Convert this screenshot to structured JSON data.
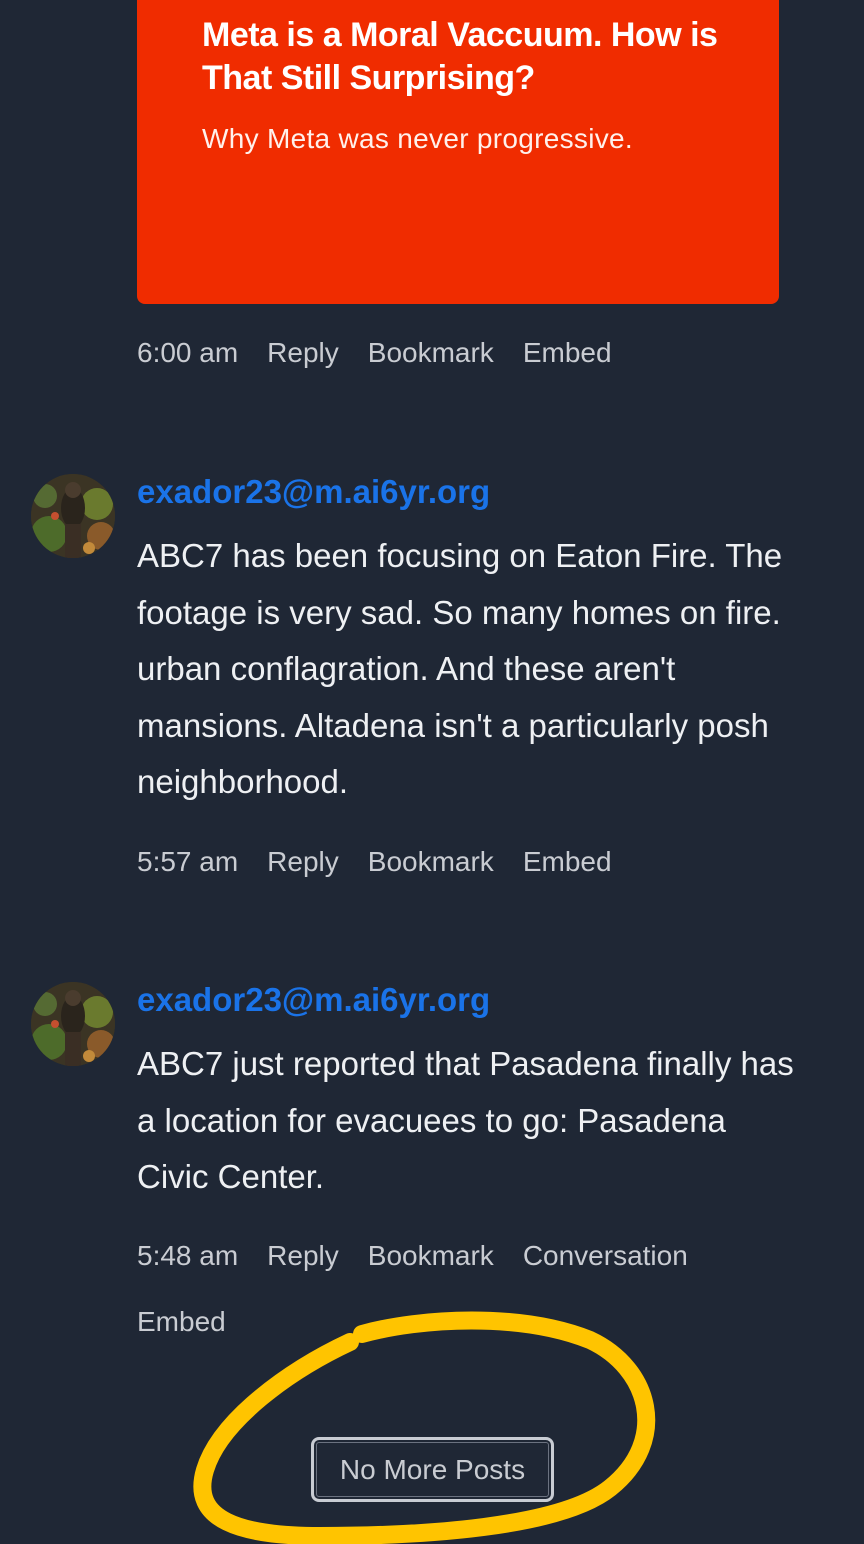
{
  "card": {
    "title": "Meta is a Moral Vaccuum. How is That Still Surprising?",
    "subtitle": "Why Meta was never progressive.",
    "color": "#f02c00"
  },
  "first_meta": {
    "time": "6:00 am",
    "reply": "Reply",
    "bookmark": "Bookmark",
    "embed": "Embed"
  },
  "posts": [
    {
      "author": "exador23@m.ai6yr.org",
      "content": "ABC7 has been focusing on Eaton Fire. The footage is very sad. So many homes on fire. urban conflagration. And these aren't mansions. Altadena isn't a particularly posh neighborhood.",
      "time": "5:57 am",
      "reply": "Reply",
      "bookmark": "Bookmark",
      "embed": "Embed"
    },
    {
      "author": "exador23@m.ai6yr.org",
      "content": "ABC7 just reported that Pasadena finally has a location for evacuees to go: Pasadena Civic Center.",
      "time": "5:48 am",
      "reply": "Reply",
      "bookmark": "Bookmark",
      "conversation": "Conversation",
      "embed": "Embed"
    }
  ],
  "footer": {
    "button_label": "No More Posts"
  },
  "colors": {
    "background": "#1f2735",
    "author_link": "#1a73e8",
    "annotation": "#ffc400"
  }
}
